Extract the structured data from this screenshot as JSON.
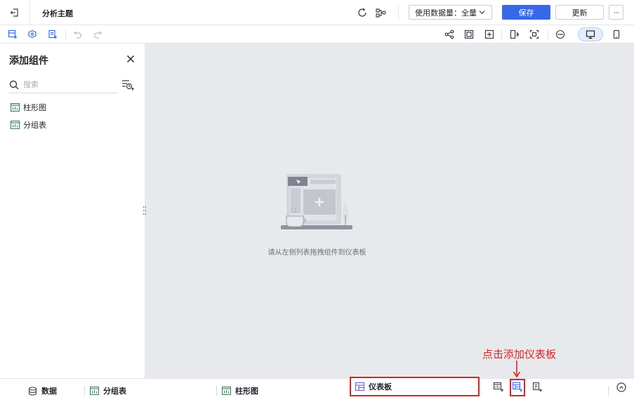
{
  "header": {
    "title": "分析主题",
    "data_select_label": "使用数据量：全量",
    "save_label": "保存",
    "update_label": "更新",
    "more_label": "···"
  },
  "toolbar": {
    "left_icons": [
      "add-component-icon",
      "add-filter-icon",
      "add-text-icon",
      "undo-icon",
      "redo-icon"
    ],
    "right_icons": [
      "share-icon",
      "screenshot-icon",
      "fit-icon",
      "layout-icon",
      "focus-icon",
      "more-circle-icon",
      "desktop-icon",
      "mobile-icon"
    ]
  },
  "panel": {
    "title": "添加组件",
    "search_placeholder": "搜索",
    "items": [
      {
        "label": "柱形图",
        "icon": "chart-icon"
      },
      {
        "label": "分组表",
        "icon": "chart-icon"
      }
    ]
  },
  "canvas": {
    "empty_text": "请从左侧列表拖拽组件到仪表板"
  },
  "bottombar": {
    "data_label": "数据",
    "tabs": [
      {
        "label": "分组表"
      },
      {
        "label": "柱形图"
      }
    ],
    "dashboard_label": "仪表板"
  },
  "annotation": {
    "text": "点击添加仪表板"
  },
  "colors": {
    "primary": "#3768e8",
    "highlight": "#e02020",
    "canvas_bg": "#e8e9ec"
  }
}
